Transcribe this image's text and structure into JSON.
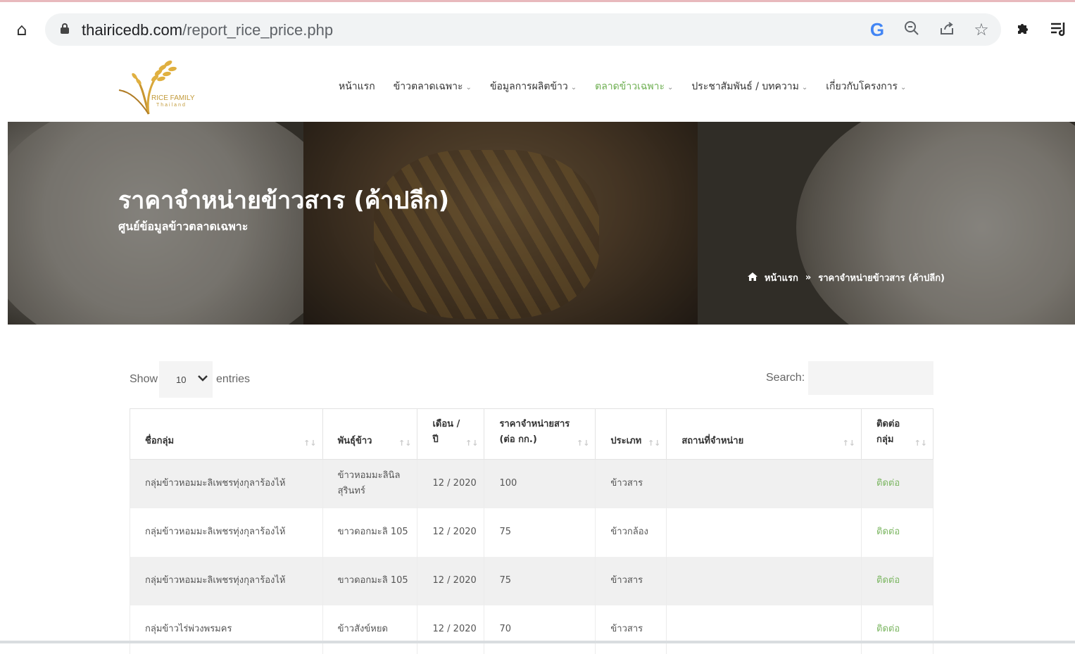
{
  "browser": {
    "url_host": "thairicedb.com",
    "url_path": "/report_rice_price.php",
    "icons": [
      "home-icon",
      "lock-icon",
      "google-icon",
      "zoom-icon",
      "share-icon",
      "star-icon",
      "extensions-icon",
      "reading-list-icon"
    ]
  },
  "logo": {
    "text": "RICE FAMILY",
    "sub": "Thailand"
  },
  "nav": {
    "items": [
      {
        "label": "หน้าแรก"
      },
      {
        "label": "ข้าวตลาดเฉพาะ"
      },
      {
        "label": "ข้อมูลการผลิตข้าว"
      },
      {
        "label": "ตลาดข้าวเฉพาะ"
      },
      {
        "label": "ประชาสัมพันธ์ / บทความ"
      },
      {
        "label": "เกี่ยวกับโครงการ"
      }
    ],
    "active_color": "#6cae4f"
  },
  "hero": {
    "title": "ราคาจำหน่ายข้าวสาร (ค้าปลีก)",
    "subtitle": "ศูนย์ข้อมูลข้าวตลาดเฉพาะ",
    "breadcrumb": {
      "home": "หน้าแรก",
      "separator": "»",
      "current": "ราคาจำหน่ายข้าวสาร (ค้าปลีก)"
    }
  },
  "controls": {
    "show_label": "Show",
    "length_value": "10",
    "entries_label": "entries",
    "search_label": "Search:",
    "search_value": ""
  },
  "table": {
    "headers": [
      "ชื่อกลุ่ม",
      "พันธุ์ข้าว",
      "เดือน / ปี",
      "ราคาจำหน่ายสาร (ต่อ กก.)",
      "ประเภท",
      "สถานที่จำหน่าย",
      "ติดต่อ กลุ่ม"
    ],
    "rows": [
      [
        "กลุ่มข้าวหอมมะลิเพชรทุ่งกุลาร้องไห้",
        "ข้าวหอมมะลินิล สุรินทร์",
        "12 / 2020",
        "100",
        "ข้าวสาร",
        "",
        "ติดต่อ"
      ],
      [
        "กลุ่มข้าวหอมมะลิเพชรทุ่งกุลาร้องไห้",
        "ขาวดอกมะลิ 105",
        "12 / 2020",
        "75",
        "ข้าวกล้อง",
        "",
        "ติดต่อ"
      ],
      [
        "กลุ่มข้าวหอมมะลิเพชรทุ่งกุลาร้องไห้",
        "ขาวดอกมะลิ 105",
        "12 / 2020",
        "75",
        "ข้าวสาร",
        "",
        "ติดต่อ"
      ],
      [
        "กลุ่มข้าวไร่พ่วงพรมคร",
        "ข้าวสังข์หยด",
        "12 / 2020",
        "70",
        "ข้าวสาร",
        "",
        "ติดต่อ"
      ]
    ],
    "contact_color": "#7bb661"
  }
}
